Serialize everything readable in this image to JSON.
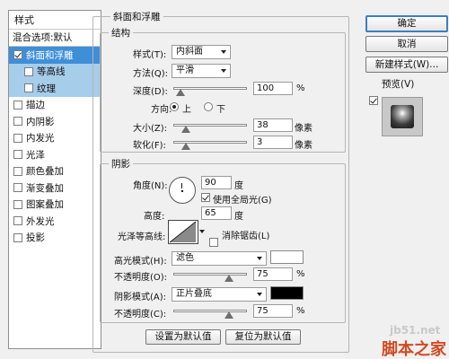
{
  "left_panel": {
    "header": "样式",
    "blend_default": "混合选项:默认",
    "items": [
      {
        "label": "斜面和浮雕",
        "checked": true
      },
      {
        "label": "等高线",
        "checked": false
      },
      {
        "label": "纹理",
        "checked": false
      },
      {
        "label": "描边",
        "checked": false
      },
      {
        "label": "内阴影",
        "checked": false
      },
      {
        "label": "内发光",
        "checked": false
      },
      {
        "label": "光泽",
        "checked": false
      },
      {
        "label": "颜色叠加",
        "checked": false
      },
      {
        "label": "渐变叠加",
        "checked": false
      },
      {
        "label": "图案叠加",
        "checked": false
      },
      {
        "label": "外发光",
        "checked": false
      },
      {
        "label": "投影",
        "checked": false
      }
    ]
  },
  "bevel": {
    "title": "斜面和浮雕",
    "structure_title": "结构",
    "style_label": "样式(T):",
    "style_value": "内斜面",
    "technique_label": "方法(Q):",
    "technique_value": "平滑",
    "depth_label": "深度(D):",
    "depth_value": "100",
    "depth_unit": "%",
    "direction_label": "方向:",
    "direction_up": "上",
    "direction_down": "下",
    "size_label": "大小(Z):",
    "size_value": "38",
    "size_unit": "像素",
    "soften_label": "软化(F):",
    "soften_value": "3",
    "soften_unit": "像素",
    "sliders": {
      "depth": 0.1,
      "size": 0.15,
      "soften": 0.05
    }
  },
  "shading": {
    "title": "阴影",
    "angle_label": "角度(N):",
    "angle_value": "90",
    "angle_unit": "度",
    "global_light_label": "使用全局光(G)",
    "altitude_label": "高度:",
    "altitude_value": "65",
    "altitude_unit": "度",
    "gloss_contour_label": "光泽等高线:",
    "anti_alias_label": "消除锯齿(L)",
    "highlight_mode_label": "高光模式(H):",
    "highlight_mode_value": "滤色",
    "highlight_color": "#ffffff",
    "highlight_opacity_label": "不透明度(O):",
    "highlight_opacity_value": "75",
    "shadow_mode_label": "阴影模式(A):",
    "shadow_mode_value": "正片叠底",
    "shadow_color": "#000000",
    "shadow_opacity_label": "不透明度(C):",
    "shadow_opacity_value": "75",
    "percent": "%",
    "sliders": {
      "highlight_opacity": 0.75,
      "shadow_opacity": 0.75
    }
  },
  "bottom_buttons": {
    "make_default": "设置为默认值",
    "reset_default": "复位为默认值"
  },
  "right_panel": {
    "ok": "确定",
    "cancel": "取消",
    "new_style": "新建样式(W)...",
    "preview": "预览(V)"
  },
  "watermark": {
    "url": "jb51.net",
    "cn": "脚本之家"
  }
}
